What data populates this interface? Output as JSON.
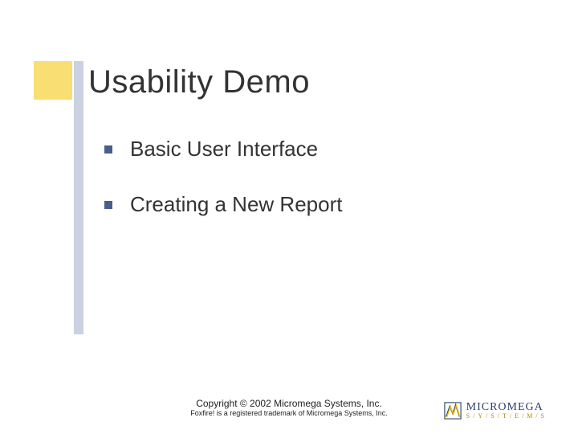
{
  "title": "Usability Demo",
  "bullets": [
    {
      "text": "Basic User Interface"
    },
    {
      "text": "Creating a New Report"
    }
  ],
  "footer": {
    "copyright": "Copyright © 2002 Micromega Systems, Inc.",
    "trademark": "Foxfire! is a registered trademark of Micromega Systems, Inc."
  },
  "logo": {
    "name": "MICROMEGA",
    "subline": "S/Y/S/T/E/M/S"
  }
}
